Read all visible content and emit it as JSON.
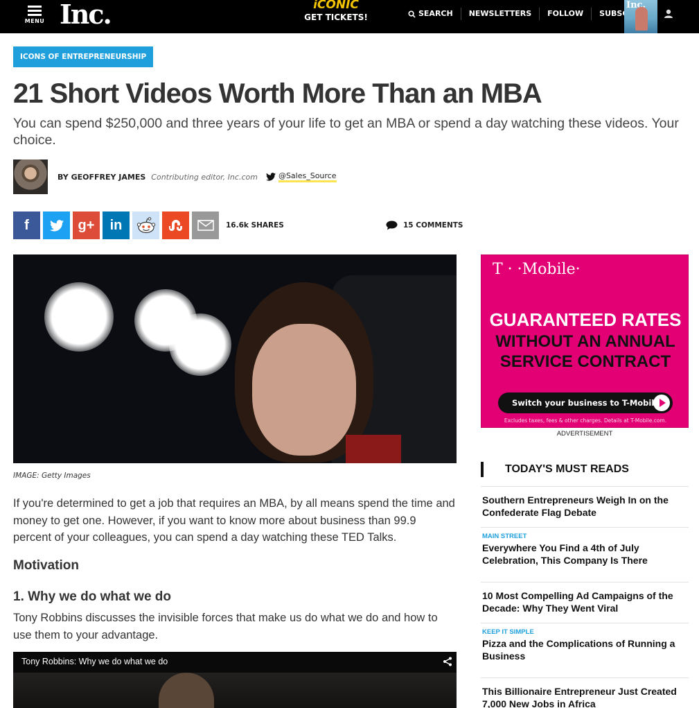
{
  "header": {
    "menu_label": "MENU",
    "logo": "Inc.",
    "promo_brand": "iCONIC",
    "promo_cta": "GET TICKETS!",
    "nav": [
      "SEARCH",
      "NEWSLETTERS",
      "FOLLOW",
      "SUBSCRIBE"
    ],
    "magazine_cover_title": "Inc."
  },
  "article": {
    "category": "ICONS OF ENTREPRENEURSHIP",
    "headline": "21 Short Videos Worth More Than an MBA",
    "dek": "You can spend $250,000 and three years of your life to get an MBA or spend a day watching these videos. Your choice.",
    "byline": {
      "author": "BY GEOFFREY JAMES",
      "title": "Contributing editor, Inc.com",
      "twitter_handle": "@Sales_Source"
    },
    "share": {
      "buttons": [
        "facebook-icon",
        "twitter-icon",
        "google-plus-icon",
        "linkedin-icon",
        "reddit-icon",
        "stumbleupon-icon",
        "email-icon"
      ],
      "facebook_glyph": "f",
      "google_glyph": "g+",
      "linkedin_glyph": "in",
      "shares": "16.6k SHARES",
      "comments": "15 COMMENTS"
    },
    "image_caption": "IMAGE: Getty Images",
    "paragraph1": "If you're determined to get a job that requires an MBA, by all means spend the time and money to get one. However, if you want to know more about business than 99.9 percent of your colleagues, you can spend a day watching these TED Talks.",
    "section_heading": "Motivation",
    "item1_heading": "1. Why we do what we do",
    "item1_text": "Tony Robbins discusses the invisible forces that make us do what we do and how to use them to your advantage.",
    "video_title": "Tony Robbins: Why we do what we do"
  },
  "sidebar": {
    "ad": {
      "brand": "T · ·Mobile·",
      "line1": "GUARANTEED RATES",
      "line2a": "WITHOUT AN ANNUAL",
      "line2b": "SERVICE CONTRACT",
      "cta": "Switch your business to T-Mobile",
      "fine_print": "Excludes taxes, fees & other charges. Details at T-Mobile.com.",
      "brand_color": "#e20074"
    },
    "ad_label": "ADVERTISEMENT",
    "must_reads_title": "TODAY'S MUST READS",
    "must_reads": [
      {
        "kicker": "",
        "title": "Southern Entrepreneurs Weigh In on the Confederate Flag Debate"
      },
      {
        "kicker": "MAIN STREET",
        "title": "Everywhere You Find a 4th of July Celebration, This Company Is There"
      },
      {
        "kicker": "",
        "title": "10 Most Compelling Ad Campaigns of the Decade: Why They Went Viral"
      },
      {
        "kicker": "KEEP IT SIMPLE",
        "title": "Pizza and the Complications of Running a Business"
      },
      {
        "kicker": "",
        "title": "This Billionaire Entrepreneur Just Created 7,000 New Jobs in Africa"
      }
    ]
  },
  "colors": {
    "accent": "#1fa0dc",
    "top_bar": "#000000",
    "handle_underline": "#ffe34f"
  }
}
